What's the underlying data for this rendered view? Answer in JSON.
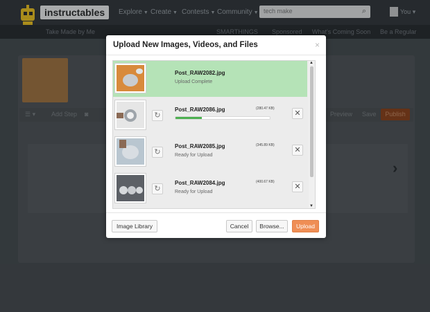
{
  "site": {
    "logo_text": "instructables",
    "nav": [
      "Explore",
      "Create",
      "Contests",
      "Community"
    ],
    "search_query": "tech make",
    "user_name": "You",
    "subbar": [
      "Take Made by Me",
      "SMARTHINGS",
      "Sponsored",
      "What's Coming Soon",
      "Be a Regular"
    ]
  },
  "editor": {
    "toolbar": [
      "Add Step",
      "Preview",
      "Save"
    ],
    "publish_label": "Publish"
  },
  "modal": {
    "title": "Upload New Images, Videos, and Files",
    "close_glyph": "×",
    "files": [
      {
        "name": "Post_RAW2082.jpg",
        "status": "Upload Complete",
        "size": "",
        "complete": true
      },
      {
        "name": "Post_RAW2086.jpg",
        "status": "",
        "size": "(280.47 KB)",
        "progress": 0.28
      },
      {
        "name": "Post_RAW2085.jpg",
        "status": "Ready for Upload",
        "size": "(345.89 KB)"
      },
      {
        "name": "Post_RAW2084.jpg",
        "status": "Ready for Upload",
        "size": "(400.67 KB)"
      }
    ],
    "buttons": {
      "library": "Image Library",
      "cancel": "Cancel",
      "browse": "Browse...",
      "upload": "Upload"
    }
  },
  "colors": {
    "complete_row": "#b5e3b7",
    "progress": "#4cb050",
    "upload_button": "#ef8e55"
  }
}
